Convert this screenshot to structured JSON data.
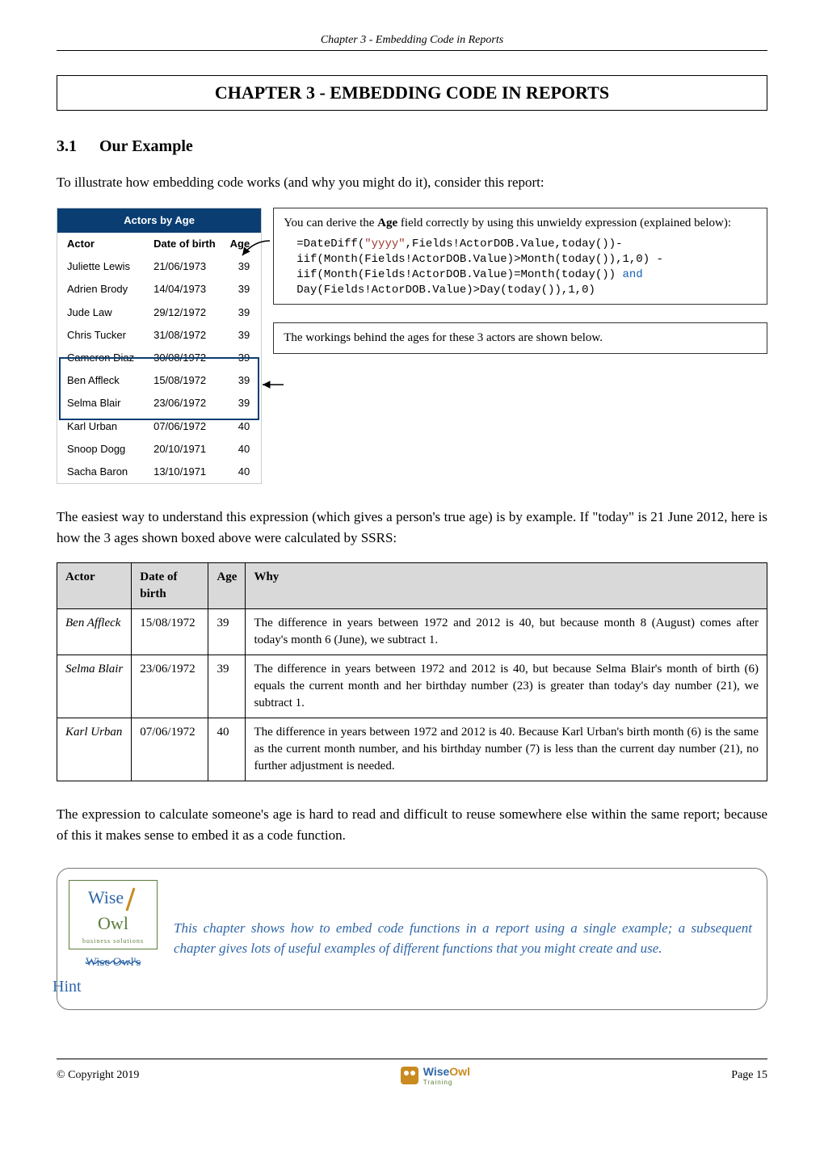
{
  "page_header": "Chapter 3 - Embedding Code in Reports",
  "chapter_title": "CHAPTER 3 - EMBEDDING CODE IN REPORTS",
  "section": {
    "num": "3.1",
    "title": "Our Example"
  },
  "intro": "To illustrate how embedding code works (and why you might do it), consider this report:",
  "actors_report": {
    "title": "Actors by Age",
    "cols": {
      "actor": "Actor",
      "dob": "Date of birth",
      "age": "Age"
    },
    "rows": [
      {
        "actor": "Juliette Lewis",
        "dob": "21/06/1973",
        "age": "39"
      },
      {
        "actor": "Adrien Brody",
        "dob": "14/04/1973",
        "age": "39"
      },
      {
        "actor": "Jude Law",
        "dob": "29/12/1972",
        "age": "39"
      },
      {
        "actor": "Chris Tucker",
        "dob": "31/08/1972",
        "age": "39"
      },
      {
        "actor": "Cameron Diaz",
        "dob": "30/08/1972",
        "age": "39"
      },
      {
        "actor": "Ben Affleck",
        "dob": "15/08/1972",
        "age": "39"
      },
      {
        "actor": "Selma Blair",
        "dob": "23/06/1972",
        "age": "39"
      },
      {
        "actor": "Karl Urban",
        "dob": "07/06/1972",
        "age": "40"
      },
      {
        "actor": "Snoop Dogg",
        "dob": "20/10/1971",
        "age": "40"
      },
      {
        "actor": "Sacha Baron",
        "dob": "13/10/1971",
        "age": "40"
      }
    ]
  },
  "callout1": {
    "lead_a": "You can derive the ",
    "lead_bold": "Age",
    "lead_b": " field correctly by using this unwieldy expression (explained below):",
    "code": {
      "l1a": "=DateDiff(",
      "l1s": "\"yyyy\"",
      "l1b": ",Fields!ActorDOB.Value,today())-",
      "l2": "iif(Month(Fields!ActorDOB.Value)>Month(today()),1,0) -",
      "l3a": "iif(Month(Fields!ActorDOB.Value)=Month(today()) ",
      "l3k": "and",
      "l4": "Day(Fields!ActorDOB.Value)>Day(today()),1,0)"
    }
  },
  "callout2": "The workings behind the ages for these 3 actors  are shown below.",
  "para2": "The easiest way to understand this expression (which gives a person's true age) is by example. If \"today\" is 21 June 2012, here is how the 3 ages shown boxed above were calculated by SSRS:",
  "why_table": {
    "head": {
      "actor": "Actor",
      "dob": "Date of birth",
      "age": "Age",
      "why": "Why"
    },
    "rows": [
      {
        "actor": "Ben Affleck",
        "dob": "15/08/1972",
        "age": "39",
        "why": "The difference in years between 1972 and 2012 is 40, but because month 8 (August) comes after today's month 6 (June), we subtract 1."
      },
      {
        "actor": "Selma Blair",
        "dob": "23/06/1972",
        "age": "39",
        "why": "The difference in years between 1972 and 2012 is 40, but because Selma Blair's month of birth (6) equals the current month and her birthday number (23) is greater than today's day number (21), we subtract 1."
      },
      {
        "actor": "Karl Urban",
        "dob": "07/06/1972",
        "age": "40",
        "why": "The difference in years between 1972 and 2012 is 40.  Because Karl Urban's birth month (6) is the same as the current month number, and his birthday number (7) is less than the current day number (21), no further adjustment is needed."
      }
    ]
  },
  "para3": "The expression to calculate someone's age is hard to read and difficult to reuse somewhere else within the same report; because of this it makes sense to embed it as a code function.",
  "hint": {
    "logo": {
      "wise": "Wise",
      "owl": "Owl",
      "sub": "business   solutions",
      "struck": "Wise   Owl's",
      "label": "Hint"
    },
    "text": "This chapter shows how to embed code functions in a report using a single example; a subsequent chapter gives lots of useful examples of different functions that you might create and use."
  },
  "footer": {
    "left": "© Copyright 2019",
    "center": {
      "wise": "Wise",
      "owl": "Owl",
      "train": "Training"
    },
    "right": "Page 15"
  }
}
